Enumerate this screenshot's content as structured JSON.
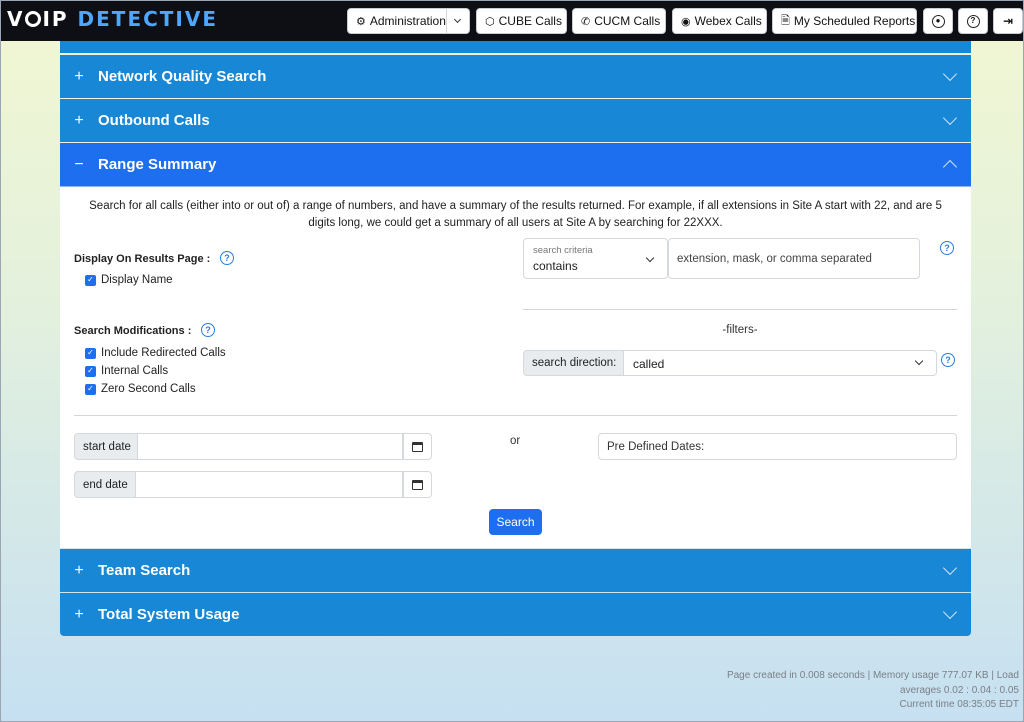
{
  "app": {
    "brand": "VOIP DETECTIVE"
  },
  "nav": {
    "administration": "Administration",
    "cube_calls": "CUBE Calls",
    "cucm_calls": "CUCM Calls",
    "webex_calls": "Webex Calls",
    "scheduled_reports": "My Scheduled Reports"
  },
  "accordion": {
    "network_quality": "Network Quality Search",
    "outbound_calls": "Outbound Calls",
    "range_summary": "Range Summary",
    "team_search": "Team Search",
    "total_system_usage": "Total System Usage",
    "collapsed_sign": "+",
    "expanded_sign": "−"
  },
  "range": {
    "description": "Search for all calls (either into or out of) a range of numbers, and have a summary of the results returned. For example, if all extensions in Site A start with 22, and are 5 digits long, we could get a summary of all users at Site A by searching for 22XXX.",
    "display_label": "Display On Results Page :",
    "display_name": "Display Name",
    "mods_label": "Search Modifications :",
    "include_redirected": "Include Redirected Calls",
    "internal_calls": "Internal Calls",
    "zero_second": "Zero Second Calls",
    "criteria_small": "search criteria",
    "criteria_value": "contains",
    "criteria_placeholder": "extension, mask, or comma separated",
    "filters": "-filters-",
    "direction_label": "search direction:",
    "direction_value": "called",
    "start_date": "start date",
    "end_date": "end date",
    "or": "or",
    "predefined": "Pre Defined Dates:",
    "search_button": "Search"
  },
  "footer": {
    "line1": "Page created in 0.008 seconds | Memory usage 777.07 KB | Load",
    "line2": "averages 0.02 : 0.04 : 0.05",
    "line3": "Current time 08:35:05 EDT"
  }
}
